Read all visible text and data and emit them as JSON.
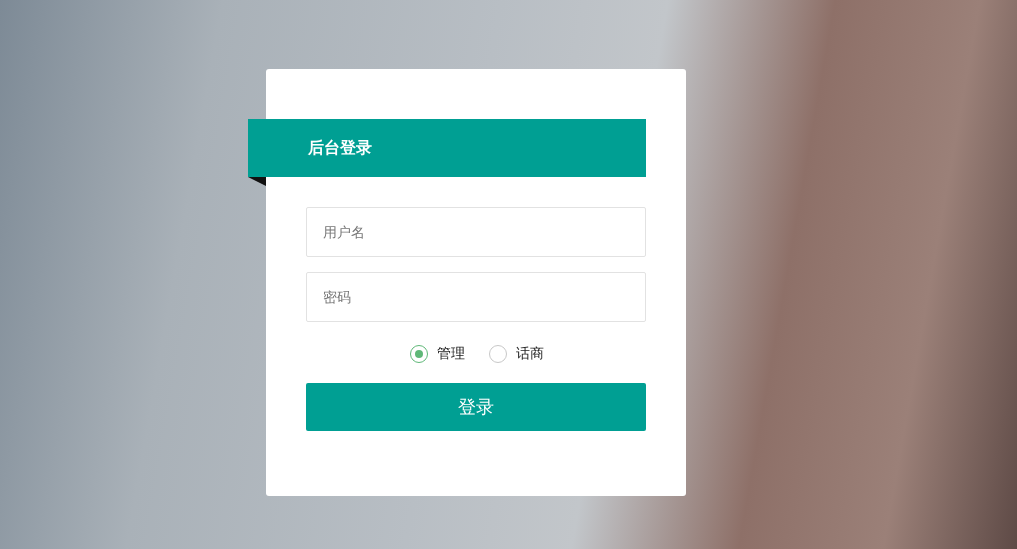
{
  "header": {
    "title": "后台登录"
  },
  "fields": [
    {
      "placeholder": "用户名"
    },
    {
      "placeholder": "密码"
    }
  ],
  "roles": [
    {
      "label": "管理",
      "selected": true
    },
    {
      "label": "话商",
      "selected": false
    }
  ],
  "submit": {
    "label": "登录"
  }
}
